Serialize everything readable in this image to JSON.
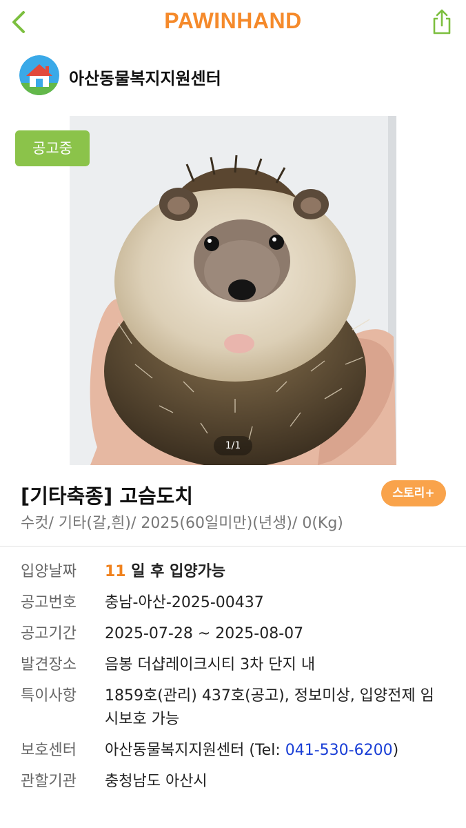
{
  "header": {
    "logo": "PAWINHAND",
    "back_icon": "chevron-left-icon",
    "share_icon": "share-icon",
    "accent_color": "#f58a2b"
  },
  "shelter": {
    "name": "아산동물복지지원센터",
    "avatar_icon": "house-avatar-icon"
  },
  "photo": {
    "status_badge": "공고중",
    "counter": "1/1",
    "badge_color": "#8bc34a"
  },
  "animal": {
    "title": "[기타축종] 고슴도치",
    "story_button": "스토리+",
    "summary": "수컷/ 기타(갈,흰)/ 2025(60일미만)(년생)/ 0(Kg)"
  },
  "details": {
    "adoption_date": {
      "label": "입양날짜",
      "days": "11",
      "text": " 일 후 입양가능"
    },
    "notice_number": {
      "label": "공고번호",
      "value": "충남-아산-2025-00437"
    },
    "notice_period": {
      "label": "공고기간",
      "value": "2025-07-28 ~ 2025-08-07"
    },
    "found_place": {
      "label": "발견장소",
      "value": "음봉 더샵레이크시티 3차 단지 내"
    },
    "special_notes": {
      "label": "특이사항",
      "value": "1859호(관리) 437호(공고), 정보미상, 입양전제 임시보호 가능"
    },
    "shelter_center": {
      "label": "보호센터",
      "name": "아산동물복지지원센터 (Tel: ",
      "tel": "041-530-6200",
      "suffix": ")"
    },
    "jurisdiction": {
      "label": "관할기관",
      "value": "충청남도 아산시"
    }
  }
}
